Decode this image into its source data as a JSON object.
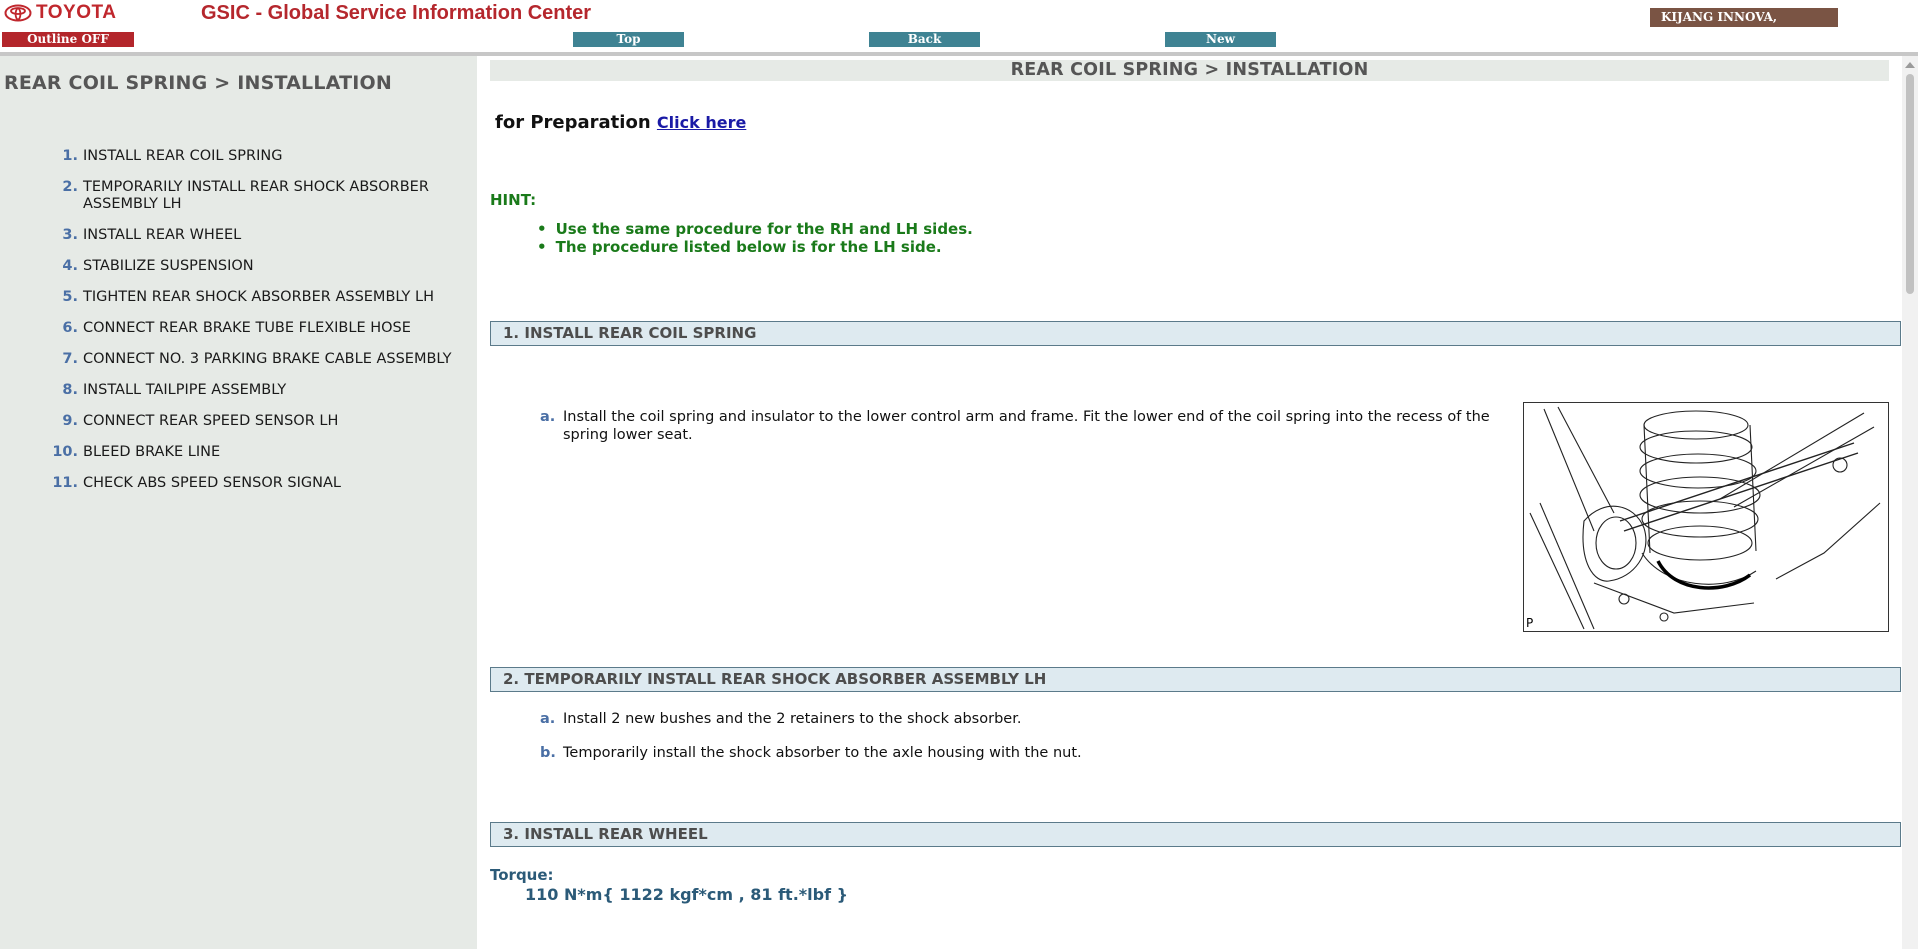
{
  "header": {
    "brand": "TOYOTA",
    "app_title": "GSIC - Global Service Information Center",
    "outline_button": "Outline OFF",
    "nav": {
      "top": "Top",
      "back": "Back",
      "new": "New"
    },
    "vehicle": "KIJANG INNOVA,"
  },
  "sidebar": {
    "title": "REAR COIL SPRING > INSTALLATION",
    "items": [
      {
        "num": "1.",
        "label": "INSTALL REAR COIL SPRING"
      },
      {
        "num": "2.",
        "label": "TEMPORARILY INSTALL REAR SHOCK ABSORBER ASSEMBLY LH"
      },
      {
        "num": "3.",
        "label": "INSTALL REAR WHEEL"
      },
      {
        "num": "4.",
        "label": "STABILIZE SUSPENSION"
      },
      {
        "num": "5.",
        "label": "TIGHTEN REAR SHOCK ABSORBER ASSEMBLY LH"
      },
      {
        "num": "6.",
        "label": "CONNECT REAR BRAKE TUBE FLEXIBLE HOSE"
      },
      {
        "num": "7.",
        "label": "CONNECT NO. 3 PARKING BRAKE CABLE ASSEMBLY"
      },
      {
        "num": "8.",
        "label": "INSTALL TAILPIPE ASSEMBLY"
      },
      {
        "num": "9.",
        "label": "CONNECT REAR SPEED SENSOR LH"
      },
      {
        "num": "10.",
        "label": "BLEED BRAKE LINE"
      },
      {
        "num": "11.",
        "label": "CHECK ABS SPEED SENSOR SIGNAL"
      }
    ]
  },
  "main": {
    "title": "REAR COIL SPRING > INSTALLATION",
    "preparation_text": "for Preparation",
    "preparation_link": "Click here",
    "hint_label": "HINT:",
    "hints": [
      "Use the same procedure for the RH and LH sides.",
      "The procedure listed below is for the LH side."
    ],
    "sections": [
      {
        "title": "1. INSTALL REAR COIL SPRING",
        "steps": [
          {
            "label": "a.",
            "text": "Install the coil spring and insulator to the lower control arm and frame. Fit the lower end of the coil spring into the recess of the spring lower seat."
          }
        ],
        "figure_caption": "P"
      },
      {
        "title": "2. TEMPORARILY INSTALL REAR SHOCK ABSORBER ASSEMBLY LH",
        "steps": [
          {
            "label": "a.",
            "text": "Install 2 new bushes and the 2 retainers to the shock absorber."
          },
          {
            "label": "b.",
            "text": "Temporarily install the shock absorber to the axle housing with the nut."
          }
        ]
      },
      {
        "title": "3. INSTALL REAR WHEEL",
        "torque_label": "Torque:",
        "torque_value": "110 N*m{ 1122 kgf*cm , 81 ft.*lbf }"
      }
    ]
  },
  "colors": {
    "brand_red": "#c0272d",
    "nav_teal": "#3f8393",
    "vehicle_brown": "#7a5444",
    "sidebar_bg": "#e6eae6",
    "hint_green": "#1a7a1a",
    "section_bg": "#deeaf0",
    "link_blue": "#1a1aa6"
  },
  "icons": {
    "brand_logo": "toyota-logo-icon"
  }
}
